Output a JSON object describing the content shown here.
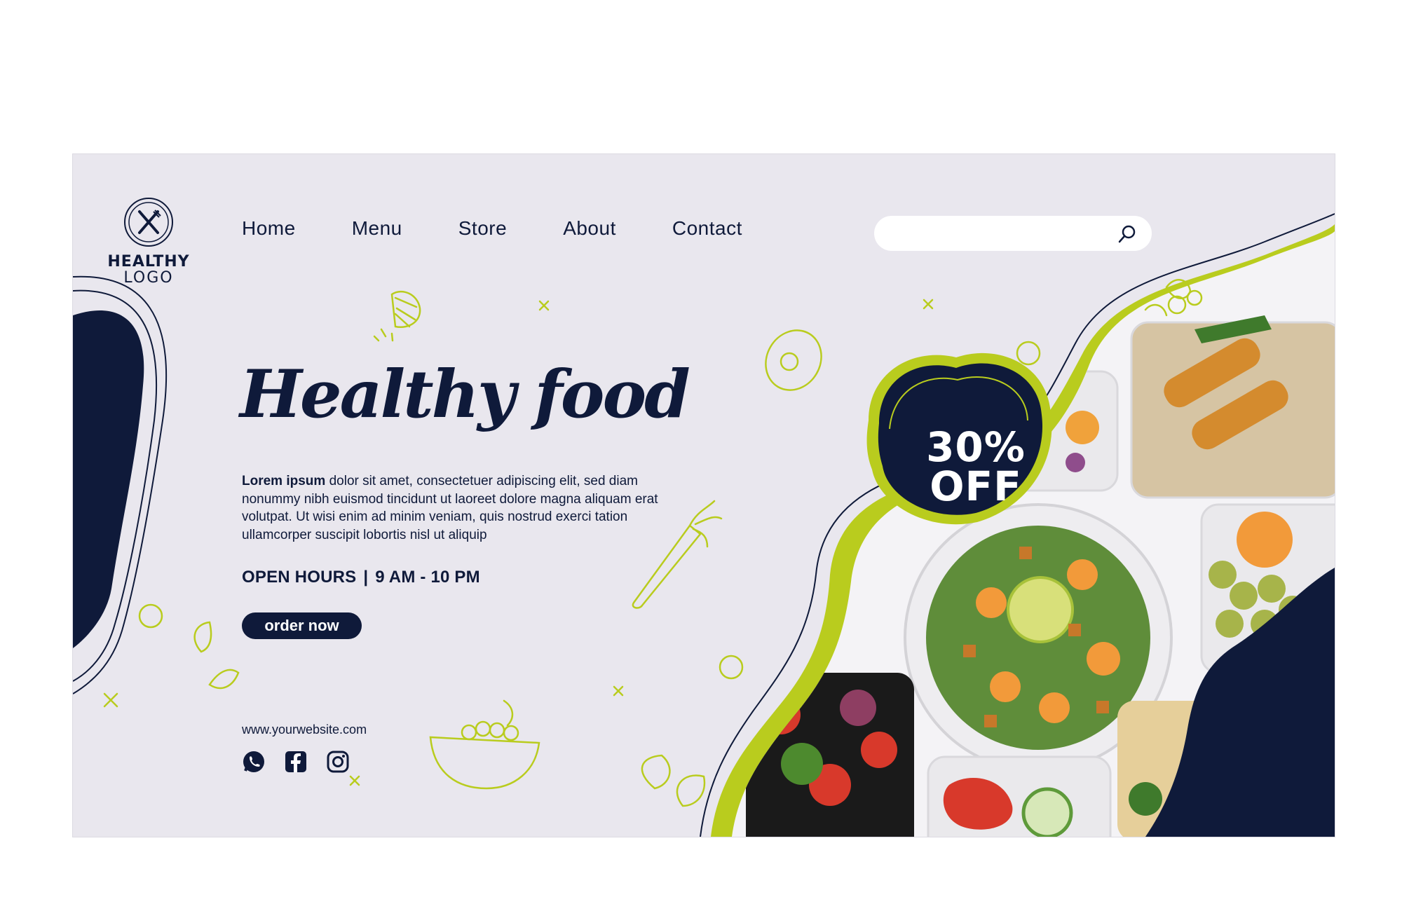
{
  "brand": {
    "logo_line1": "HEALTHY",
    "logo_line2": "LOGO",
    "logo_icon": "fork-knife-icon"
  },
  "nav": {
    "items": [
      {
        "label": "Home"
      },
      {
        "label": "Menu"
      },
      {
        "label": "Store"
      },
      {
        "label": "About"
      },
      {
        "label": "Contact"
      }
    ]
  },
  "search": {
    "value": "",
    "placeholder": "",
    "icon": "search-icon"
  },
  "hero": {
    "title": "Healthy food",
    "description_bold": "Lorem ipsum",
    "description_rest": "dolor sit amet, consectetuer adipiscing elit, sed diam nonummy nibh euismod tincidunt ut laoreet dolore magna aliquam erat volutpat. Ut wisi enim ad minim veniam, quis nostrud exerci tation ullamcorper suscipit lobortis nisl ut aliquip",
    "hours_label": "OPEN HOURS",
    "hours_separator": "|",
    "hours_value": "9 AM - 10 PM",
    "cta_label": "order now"
  },
  "promo": {
    "line1": "30%",
    "line2": "OFF"
  },
  "footer": {
    "website": "www.yourwebsite.com",
    "socials": [
      {
        "name": "whatsapp-icon"
      },
      {
        "name": "facebook-icon"
      },
      {
        "name": "instagram-icon"
      }
    ]
  },
  "colors": {
    "navy": "#0f1a3a",
    "lime": "#b9cc1e",
    "background": "#e9e7ee",
    "white": "#ffffff"
  }
}
